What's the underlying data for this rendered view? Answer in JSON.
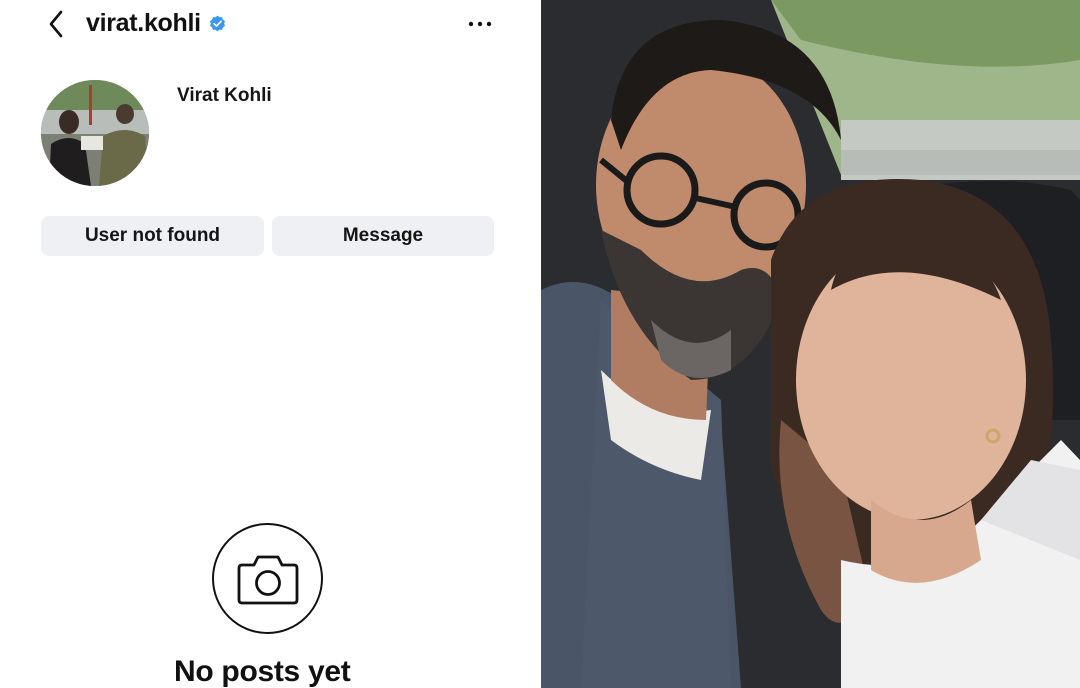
{
  "profile": {
    "username": "virat.kohli",
    "display_name": "Virat Kohli",
    "verified": true
  },
  "actions": {
    "primary_label": "User not found",
    "secondary_label": "Message"
  },
  "empty_state": {
    "title": "No posts yet"
  },
  "icons": {
    "back": "chevron-left-icon",
    "verified": "verified-badge-icon",
    "more": "more-horizontal-icon",
    "camera": "camera-icon"
  },
  "colors": {
    "verified_blue": "#3897f0",
    "button_bg": "#eef0f3",
    "text": "#111111"
  }
}
